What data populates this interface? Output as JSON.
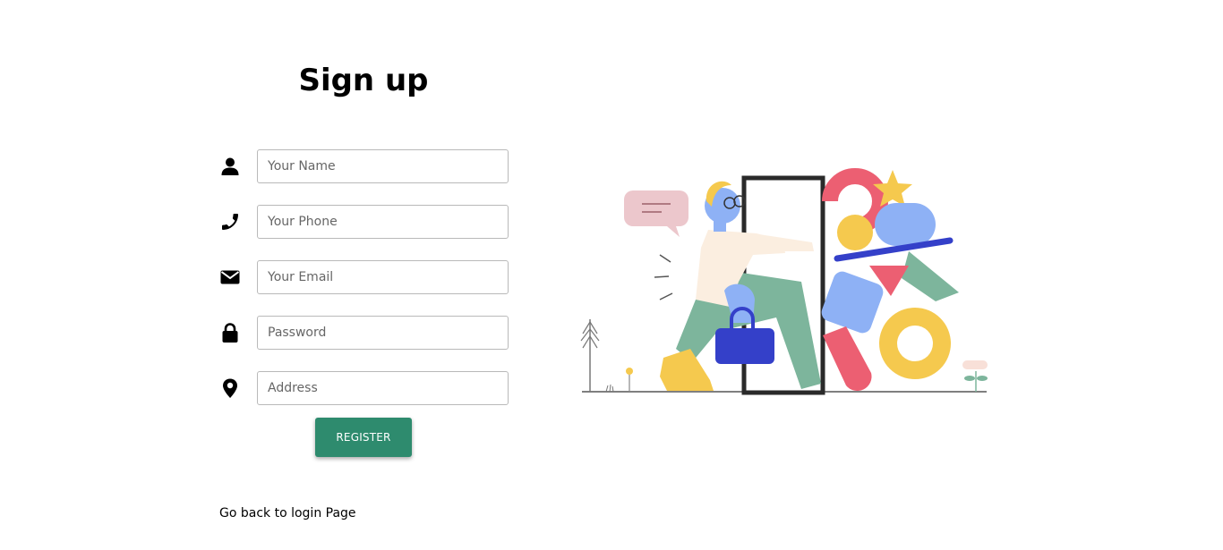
{
  "form": {
    "title": "Sign up",
    "fields": [
      {
        "icon": "user-icon",
        "placeholder": "Your Name",
        "value": ""
      },
      {
        "icon": "phone-icon",
        "placeholder": "Your Phone",
        "value": ""
      },
      {
        "icon": "envelope-icon",
        "placeholder": "Your Email",
        "value": ""
      },
      {
        "icon": "lock-icon",
        "placeholder": "Password",
        "value": ""
      },
      {
        "icon": "map-marker-icon",
        "placeholder": "Address",
        "value": ""
      }
    ],
    "register_label": "REGISTER",
    "back_link_label": "Go back to login Page"
  },
  "colors": {
    "accent": "#2e8b6e",
    "input_border": "#b9b9b9"
  },
  "illustration": {
    "icon": "person-entering-door-illustration"
  }
}
